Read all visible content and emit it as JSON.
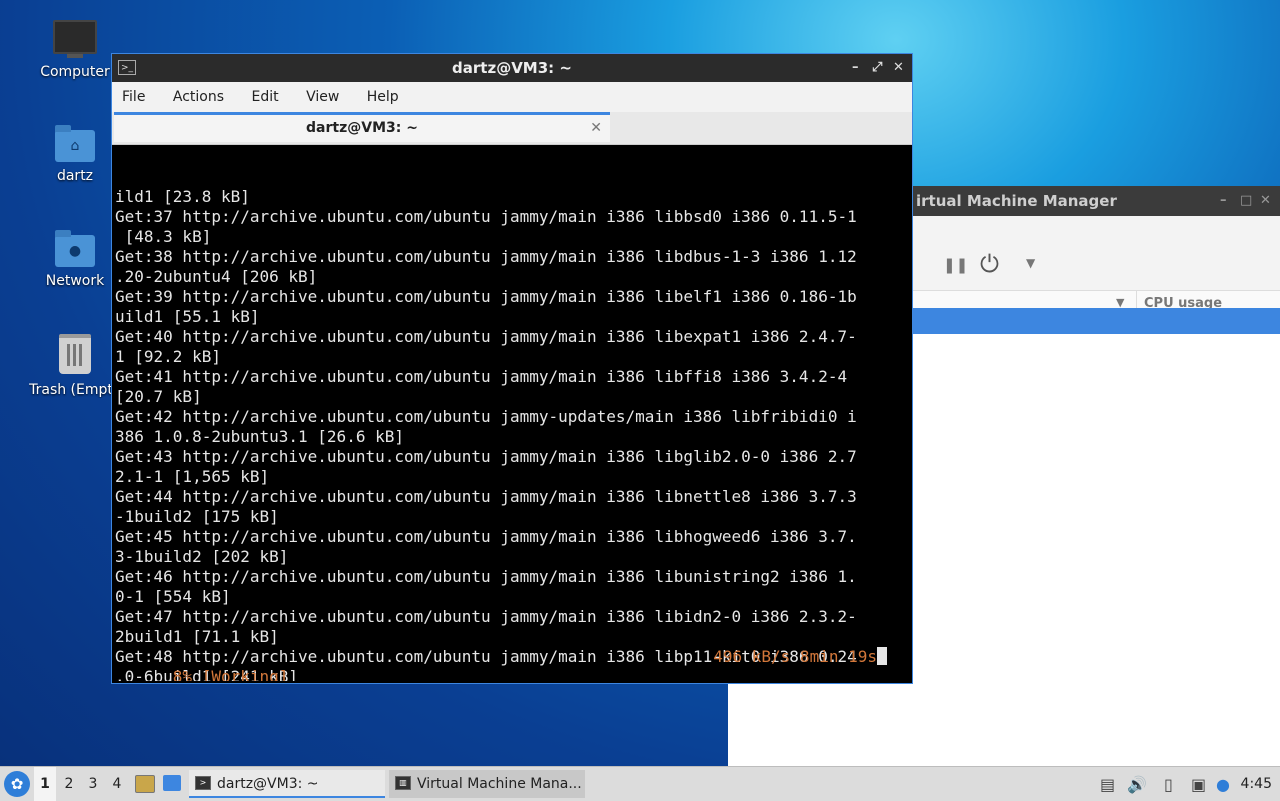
{
  "desktop": {
    "icons": [
      {
        "label": "Computer"
      },
      {
        "label": "dartz"
      },
      {
        "label": "Network"
      },
      {
        "label": "Trash (Empt"
      }
    ]
  },
  "vmm_window": {
    "title": "Virtual Machine Manager",
    "title_visible": "irtual Machine Manager",
    "column_cpu": "CPU usage"
  },
  "terminal": {
    "title": "dartz@VM3: ~",
    "menu": [
      "File",
      "Actions",
      "Edit",
      "View",
      "Help"
    ],
    "tab_label": "dartz@VM3: ~",
    "lines": [
      "ild1 [23.8 kB]",
      "Get:37 http://archive.ubuntu.com/ubuntu jammy/main i386 libbsd0 i386 0.11.5-1",
      " [48.3 kB]",
      "Get:38 http://archive.ubuntu.com/ubuntu jammy/main i386 libdbus-1-3 i386 1.12",
      ".20-2ubuntu4 [206 kB]",
      "Get:39 http://archive.ubuntu.com/ubuntu jammy/main i386 libelf1 i386 0.186-1b",
      "uild1 [55.1 kB]",
      "Get:40 http://archive.ubuntu.com/ubuntu jammy/main i386 libexpat1 i386 2.4.7-",
      "1 [92.2 kB]",
      "Get:41 http://archive.ubuntu.com/ubuntu jammy/main i386 libffi8 i386 3.4.2-4",
      "[20.7 kB]",
      "Get:42 http://archive.ubuntu.com/ubuntu jammy-updates/main i386 libfribidi0 i",
      "386 1.0.8-2ubuntu3.1 [26.6 kB]",
      "Get:43 http://archive.ubuntu.com/ubuntu jammy/main i386 libglib2.0-0 i386 2.7",
      "2.1-1 [1,565 kB]",
      "Get:44 http://archive.ubuntu.com/ubuntu jammy/main i386 libnettle8 i386 3.7.3",
      "-1build2 [175 kB]",
      "Get:45 http://archive.ubuntu.com/ubuntu jammy/main i386 libhogweed6 i386 3.7.",
      "3-1build2 [202 kB]",
      "Get:46 http://archive.ubuntu.com/ubuntu jammy/main i386 libunistring2 i386 1.",
      "0-1 [554 kB]",
      "Get:47 http://archive.ubuntu.com/ubuntu jammy/main i386 libidn2-0 i386 2.3.2-",
      "2build1 [71.1 kB]",
      "Get:48 http://archive.ubuntu.com/ubuntu jammy/main i386 libp11-kit0 i386 0.24",
      ".0-6build1 [241 kB]"
    ],
    "status_left": "8% [Working]",
    "status_right": "496 kB/s 8min 19s"
  },
  "taskbar": {
    "workspaces": [
      "1",
      "2",
      "3",
      "4"
    ],
    "tasks": [
      {
        "label": "dartz@VM3: ~"
      },
      {
        "label": "Virtual Machine Mana..."
      }
    ],
    "clock": "4:45"
  },
  "colors": {
    "accent": "#3d86e0",
    "status_text": "#d2773a"
  }
}
